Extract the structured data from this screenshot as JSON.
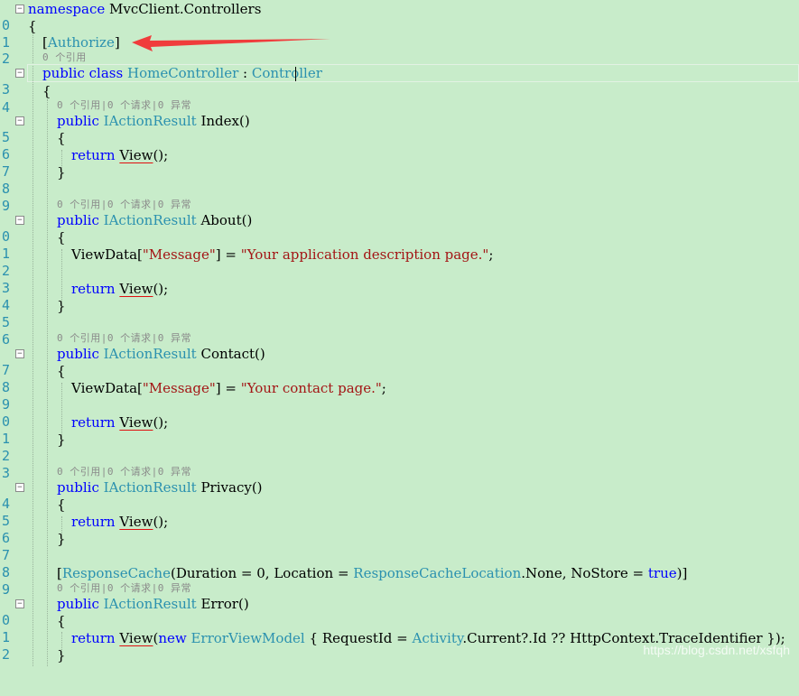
{
  "annotations": {
    "arrow_color": "#f03c3c"
  },
  "watermark": "https://blog.csdn.net/xsfqh",
  "codelens": {
    "refs": "0 个引用",
    "full": "0 个引用|0 个请求|0 异常"
  },
  "colors": {
    "background": "#c8ecca",
    "keyword": "#0000ff",
    "type": "#2b91af",
    "string": "#a31515",
    "line_number": "#2b91af"
  },
  "line_numbers": {
    "l10": "0",
    "l11": "1",
    "l12": "2",
    "l13": "3",
    "l14": "4",
    "l15": "5",
    "l16": "6",
    "l17": "7",
    "l18": "8",
    "l19": "9",
    "l20": "0",
    "l21": "1",
    "l22": "2",
    "l23": "3",
    "l24": "4",
    "l25": "5",
    "l26": "6",
    "l27": "7",
    "l28": "8",
    "l29": "9",
    "l30": "0",
    "l31": "1",
    "l32": "2",
    "l33": "3",
    "l34": "4",
    "l35": "5",
    "l36": "6",
    "l37": "7",
    "l38": "8",
    "l39": "9",
    "l40": "0",
    "l41": "1",
    "l42": "2"
  },
  "code": {
    "ns_kw": "namespace",
    "ns_name": "MvcClient.Controllers",
    "brace_open": "{",
    "brace_close": "}",
    "attr_open": "[",
    "attr_authorize": "Authorize",
    "attr_close": "]",
    "kw_public": "public",
    "kw_class": "class",
    "kw_return": "return",
    "kw_new": "new",
    "kw_true": "true",
    "class_name": "HomeController",
    "colon": " : ",
    "base_class": "Controller",
    "iaction": "IActionResult",
    "m_index": "Index()",
    "m_about": "About()",
    "m_contact": "Contact()",
    "m_privacy": "Privacy()",
    "m_error": "Error()",
    "view": "View",
    "view_end": "();",
    "viewdata_open": "ViewData[",
    "message_key": "\"Message\"",
    "viewdata_assign": "] = ",
    "semi": ";",
    "about_msg": "\"Your application description page.\"",
    "contact_msg": "\"Your contact page.\"",
    "responsecache": "ResponseCache",
    "rc_args1": "(Duration = 0, Location = ",
    "rc_location_type": "ResponseCacheLocation",
    "rc_args2": ".None, NoStore = ",
    "rc_end": ")]",
    "error_paren": "(",
    "error_model": "ErrorViewModel",
    "error_mid": " { RequestId = ",
    "activity": "Activity",
    "error_tail": ".Current?.Id ?? HttpContext.TraceIdentifier });"
  }
}
